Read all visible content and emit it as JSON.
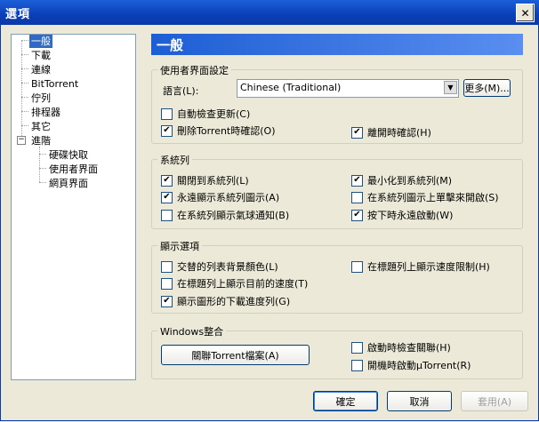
{
  "window": {
    "title": "選項",
    "close_symbol": "✕"
  },
  "tree": {
    "items": [
      {
        "label": "一般",
        "selected": true
      },
      {
        "label": "下載"
      },
      {
        "label": "連線"
      },
      {
        "label": "BitTorrent"
      },
      {
        "label": "佇列"
      },
      {
        "label": "排程器"
      },
      {
        "label": "其它"
      },
      {
        "label": "進階"
      },
      {
        "label": "硬碟快取"
      },
      {
        "label": "使用者界面"
      },
      {
        "label": "網頁界面"
      }
    ],
    "expander_symbol": "−"
  },
  "header": {
    "title": "一般"
  },
  "ui_settings": {
    "title": "使用者界面設定",
    "language_label": "語言(L):",
    "language_value": "Chinese (Traditional)",
    "more_button": "更多(M)...",
    "auto_check_updates": {
      "label": "自動檢查更新(C)",
      "checked": false
    },
    "confirm_delete": {
      "label": "刪除Torrent時確認(O)",
      "checked": true
    },
    "confirm_exit": {
      "label": "離開時確認(H)",
      "checked": true
    }
  },
  "tray": {
    "title": "系統列",
    "close_to_tray": {
      "label": "關閉到系統列(L)",
      "checked": true
    },
    "minimize_to_tray": {
      "label": "最小化到系統列(M)",
      "checked": true
    },
    "always_show_tray": {
      "label": "永遠顯示系統列圖示(A)",
      "checked": true
    },
    "single_click_open": {
      "label": "在系統列圖示上單擊來開啟(S)",
      "checked": false
    },
    "balloon_notify": {
      "label": "在系統列顯示氣球通知(B)",
      "checked": false
    },
    "always_activate": {
      "label": "按下時永遠啟動(W)",
      "checked": true
    }
  },
  "display": {
    "title": "顯示選項",
    "alternate_bg": {
      "label": "交替的列表背景顏色(L)",
      "checked": false
    },
    "title_speed_limit": {
      "label": "在標題列上顯示速度限制(H)",
      "checked": false
    },
    "title_current_speed": {
      "label": "在標題列上顯示目前的速度(T)",
      "checked": false
    },
    "graphical_progress": {
      "label": "顯示圖形的下載進度列(G)",
      "checked": true
    }
  },
  "windows": {
    "title": "Windows整合",
    "associate_button": "關聯Torrent檔案(A)",
    "check_assoc": {
      "label": "啟動時檢查關聯(H)",
      "checked": false
    },
    "start_on_boot": {
      "label": "開機時啟動µTorrent(R)",
      "checked": false
    }
  },
  "buttons": {
    "ok": "確定",
    "cancel": "取消",
    "apply": "套用(A)"
  },
  "colors": {
    "title_bar": "#0a3fb8",
    "header": "#1d5ed4",
    "selection": "#316ac5",
    "dialog_bg": "#ece9d8"
  }
}
